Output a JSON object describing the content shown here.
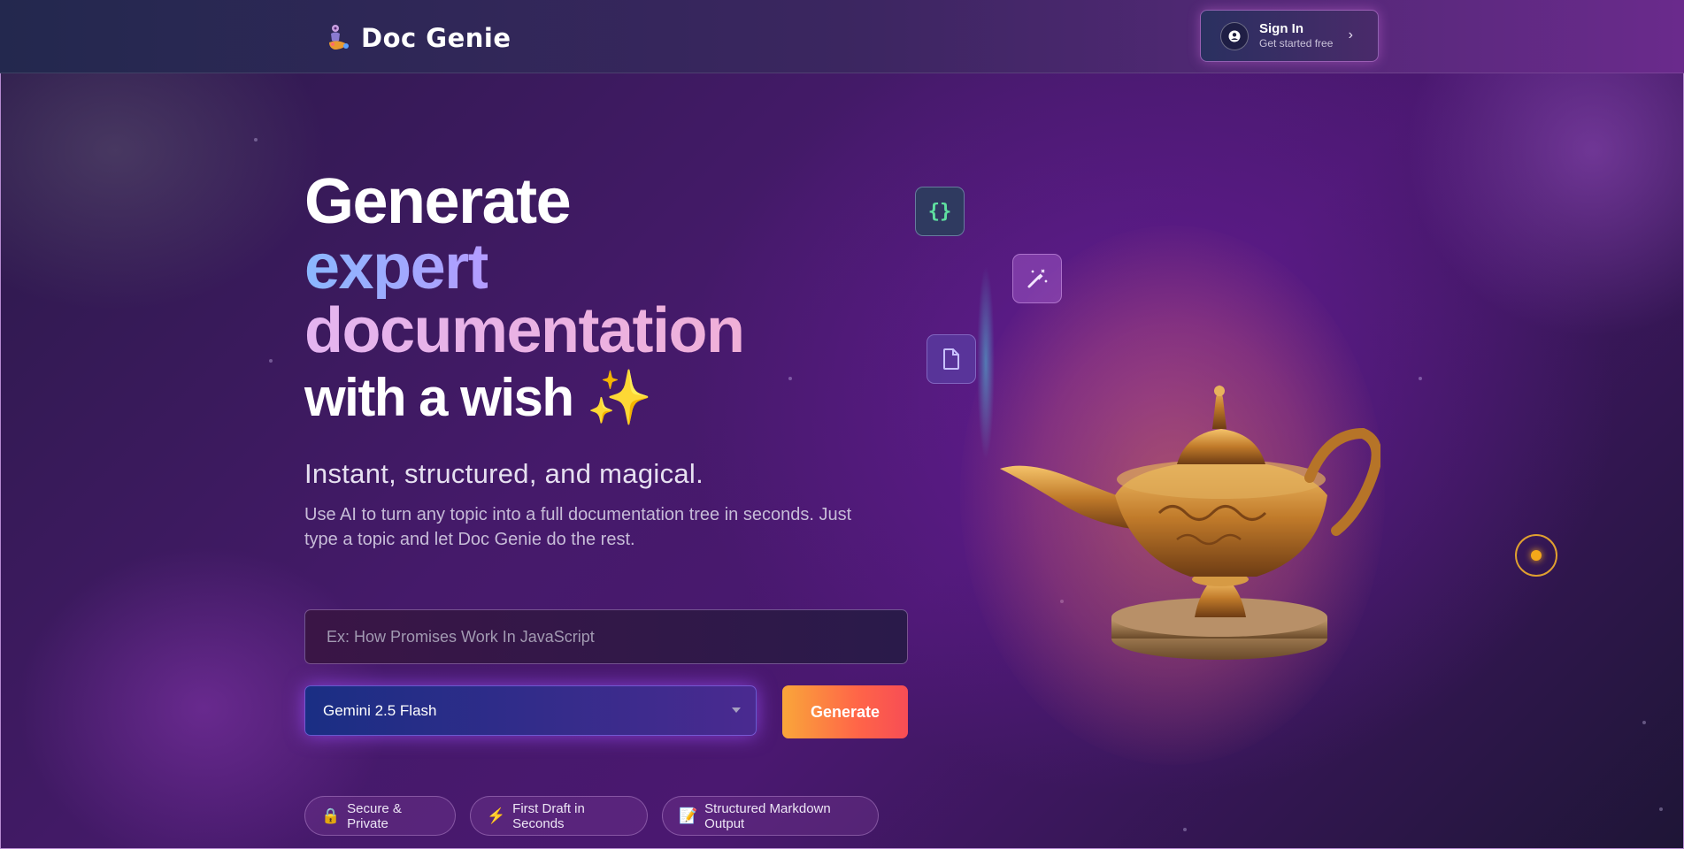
{
  "brand": {
    "name": "Doc Genie",
    "icon": "genie-mascot-icon"
  },
  "header": {
    "signin_title": "Sign In",
    "signin_subtitle": "Get started free",
    "signin_icon": "user-circle-icon",
    "chevron_icon": "chevron-right-icon",
    "chevron_glyph": "›"
  },
  "hero": {
    "line1": "Generate",
    "line2": "expert",
    "line3": "documentation",
    "line4": "with a wish ✨",
    "tagline": "Instant, structured, and magical.",
    "description": "Use AI to turn any topic into a full documentation tree in seconds. Just type a topic and let Doc Genie do the rest."
  },
  "form": {
    "topic_placeholder": "Ex: How Promises Work In JavaScript",
    "topic_value": "",
    "model_selected": "Gemini 2.5 Flash",
    "generate_label": "Generate"
  },
  "features": [
    {
      "icon": "🔒",
      "icon_name": "lock-icon",
      "label": "Secure & Private"
    },
    {
      "icon": "⚡",
      "icon_name": "lightning-icon",
      "label": "First Draft in Seconds"
    },
    {
      "icon": "📝",
      "icon_name": "memo-icon",
      "label": "Structured Markdown Output"
    }
  ],
  "floating_icons": [
    {
      "name": "code-braces-icon",
      "glyph": "{}"
    },
    {
      "name": "magic-wand-icon"
    },
    {
      "name": "document-icon"
    }
  ],
  "colors": {
    "accent_orange": "#ff6548",
    "accent_purple": "#4a1870",
    "code_green": "#5fe0a0",
    "orb_gold": "#f4a81a"
  }
}
